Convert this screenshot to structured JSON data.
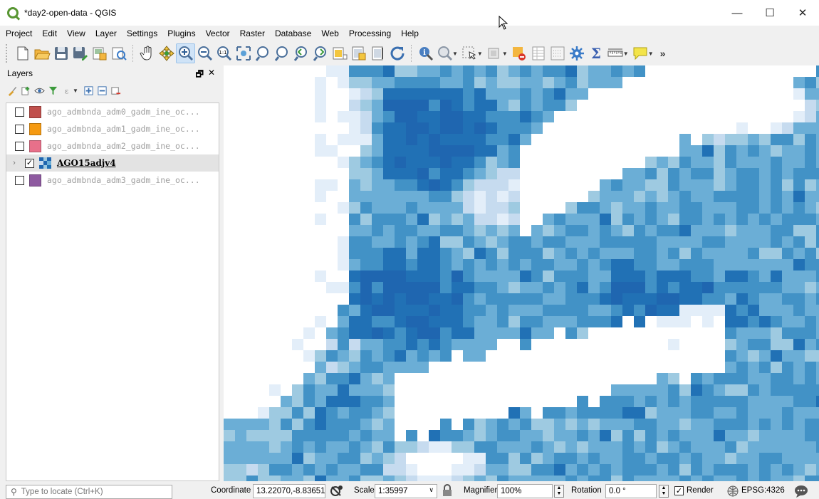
{
  "window": {
    "title": "*day2-open-data - QGIS",
    "controls": {
      "minimize": "—",
      "maximize": "☐",
      "close": "✕"
    }
  },
  "menu": [
    "Project",
    "Edit",
    "View",
    "Layer",
    "Settings",
    "Plugins",
    "Vector",
    "Raster",
    "Database",
    "Web",
    "Processing",
    "Help"
  ],
  "toolbar": {
    "icons": [
      "new-project-icon",
      "open-project-icon",
      "save-project-icon",
      "save-as-icon",
      "new-print-layout-icon",
      "layout-manager-icon",
      "pan-icon",
      "pan-to-selection-icon",
      "zoom-in-icon",
      "zoom-out-icon",
      "zoom-native-icon",
      "zoom-full-icon",
      "zoom-to-selection-icon",
      "zoom-to-layer-icon",
      "zoom-last-icon",
      "zoom-next-icon",
      "new-map-view-icon",
      "new-3d-map-view-icon",
      "temporal-controller-icon",
      "refresh-icon",
      "identify-icon",
      "measure-icon",
      "select-features-icon",
      "deselect-icon",
      "show-bookmarks-icon",
      "attribute-table-icon",
      "field-calculator-icon",
      "processing-toolbox-icon",
      "statistical-summary-icon",
      "measure-line-icon",
      "annotation-icon"
    ],
    "more": "»"
  },
  "layers_panel": {
    "title": "Layers",
    "header_buttons": [
      "🗗",
      "✕"
    ],
    "layers": [
      {
        "name": "ago_admbnda_adm0_gadm_ine_oc...",
        "color": "#c0504d",
        "checked": false,
        "active": false
      },
      {
        "name": "ago_admbnda_adm1_gadm_ine_oc...",
        "color": "#f59a12",
        "checked": false,
        "active": false
      },
      {
        "name": "ago_admbnda_adm2_gadm_ine_oc...",
        "color": "#e8708a",
        "checked": false,
        "active": false
      },
      {
        "name": "AGO15adjv4",
        "color": "#1f66b0",
        "checked": true,
        "active": true,
        "raster": true,
        "expander": "›"
      },
      {
        "name": "ago_admbnda_adm3_gadm_ine_oc...",
        "color": "#8e5aa0",
        "checked": false,
        "active": false
      }
    ]
  },
  "map": {
    "raster_colors": [
      "#ffffff",
      "#e3eef9",
      "#c6dbef",
      "#9ecae1",
      "#6baed6",
      "#4292c6",
      "#2171b5",
      "#1f66b0"
    ]
  },
  "status": {
    "locate_placeholder": "Type to locate (Ctrl+K)",
    "coordinate_label": "Coordinate",
    "coordinate_value": "13.22070,-8.83651",
    "scale_label": "Scale",
    "scale_value": "1:35997",
    "magnifier_label": "Magnifier",
    "magnifier_value": "100%",
    "rotation_label": "Rotation",
    "rotation_value": "0.0 °",
    "render_label": "Render",
    "render_checked": true,
    "crs_label": "EPSG:4326"
  }
}
